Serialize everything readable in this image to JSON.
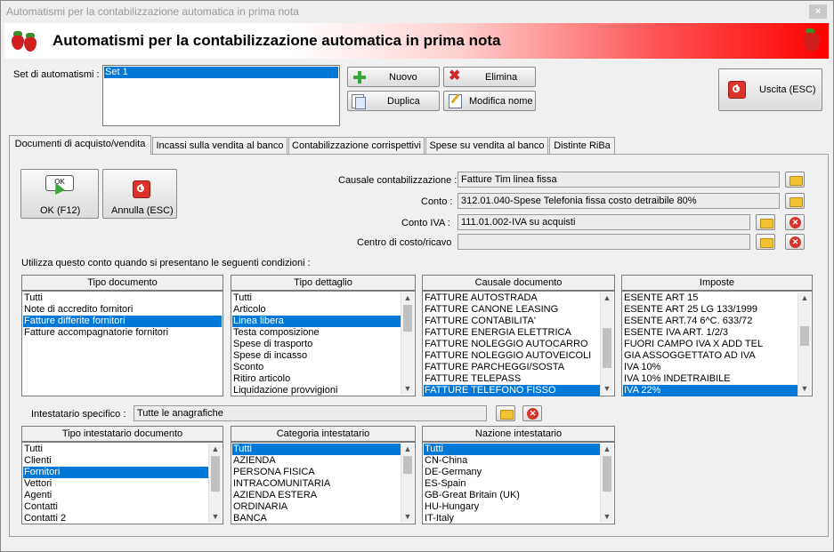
{
  "window": {
    "title": "Automatismi per la contabilizzazione automatica in prima nota",
    "close_label": "×"
  },
  "header": {
    "title": "Automatismi per la contabilizzazione automatica in prima nota"
  },
  "set": {
    "label": "Set di automatismi :",
    "items": [
      "Set 1"
    ]
  },
  "toolbar": {
    "nuovo": "Nuovo",
    "elimina": "Elimina",
    "duplica": "Duplica",
    "modifica_nome": "Modifica nome",
    "uscita": "Uscita (ESC)"
  },
  "tabs": [
    "Documenti di acquisto/vendita",
    "Incassi sulla vendita al banco",
    "Contabilizzazione corrispettivi",
    "Spese su vendita al banco",
    "Distinte RiBa"
  ],
  "actions": {
    "ok": "OK (F12)",
    "ok_icon_text": "OK",
    "annulla": "Annulla (ESC)"
  },
  "form": {
    "causale_label": "Causale contabilizzazione :",
    "causale_value": "Fatture Tim linea fissa",
    "conto_label": "Conto :",
    "conto_value": "312.01.040-Spese Telefonia fissa costo detraibile 80%",
    "conto_iva_label": "Conto IVA :",
    "conto_iva_value": "111.01.002-IVA su acquisti",
    "centro_label": "Centro di costo/ricavo",
    "centro_value": ""
  },
  "conditions_label": "Utilizza questo conto quando si presentano le seguenti condizioni :",
  "tipo_documento": {
    "header": "Tipo documento",
    "items": [
      "Tutti",
      "Note di accredito fornitori",
      "Fatture differite fornitori",
      "Fatture accompagnatorie fornitori"
    ],
    "selected": 2
  },
  "tipo_dettaglio": {
    "header": "Tipo dettaglio",
    "items": [
      "Tutti",
      "Articolo",
      "Linea libera",
      "Testa composizione",
      "Spese di trasporto",
      "Spese di incasso",
      "Sconto",
      "Ritiro articolo",
      "Liquidazione provvigioni"
    ],
    "selected": 2
  },
  "causale_documento": {
    "header": "Causale documento",
    "items": [
      "FATTURE AUTOSTRADA",
      "FATTURE CANONE LEASING",
      "FATTURE CONTABILITA'",
      "FATTURE ENERGIA ELETTRICA",
      "FATTURE NOLEGGIO AUTOCARRO",
      "FATTURE NOLEGGIO AUTOVEICOLI",
      "FATTURE PARCHEGGI/SOSTA",
      "FATTURE TELEPASS",
      "FATTURE TELEFONO FISSO"
    ],
    "selected": 8
  },
  "imposte": {
    "header": "Imposte",
    "items": [
      "ESENTE ART 15",
      "ESENTE ART 25 LG 133/1999",
      "ESENTE ART.74 6^C. 633/72",
      "ESENTE IVA ART. 1/2/3",
      "FUORI CAMPO IVA X ADD TEL",
      "GIA ASSOGGETTATO AD IVA",
      "IVA 10%",
      "IVA 10% INDETRAIBILE",
      "IVA 22%"
    ],
    "selected": 8
  },
  "intestatario": {
    "label": "Intestatario specifico :",
    "value": "Tutte le anagrafiche"
  },
  "tipo_intestatario": {
    "header": "Tipo intestatario documento",
    "items": [
      "Tutti",
      "Clienti",
      "Fornitori",
      "Vettori",
      "Agenti",
      "Contatti",
      "Contatti 2"
    ],
    "selected": 2
  },
  "categoria_intestatario": {
    "header": "Categoria intestatario",
    "items": [
      "Tutti",
      "AZIENDA",
      "PERSONA FISICA",
      "INTRACOMUNITARIA",
      "AZIENDA ESTERA",
      "ORDINARIA",
      "BANCA"
    ],
    "selected": 0
  },
  "nazione_intestatario": {
    "header": "Nazione intestatario",
    "items": [
      "Tutti",
      "CN-China",
      "DE-Germany",
      "ES-Spain",
      "GB-Great Britain (UK)",
      "HU-Hungary",
      "IT-Italy"
    ],
    "selected": 0
  },
  "colors": {
    "selection": "#0078d7",
    "header_gradient_end": "#ff0000"
  }
}
